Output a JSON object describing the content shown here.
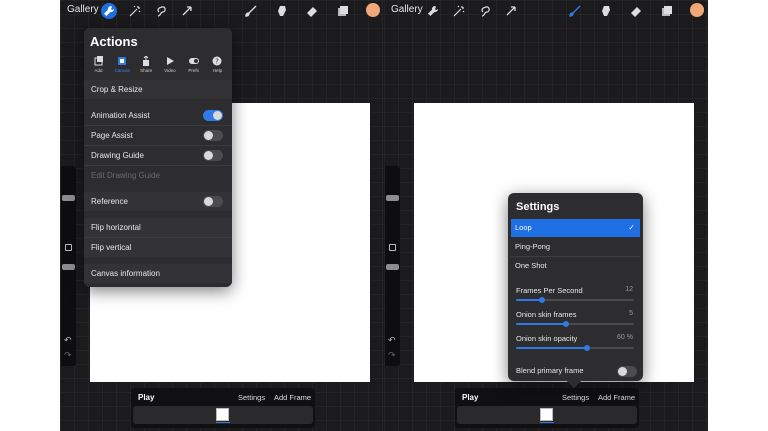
{
  "colors": {
    "accent": "#2f7ae5",
    "panel_bg": "#1b1b1d",
    "popover_bg": "#2d2d2f",
    "swatch": "#f0a878"
  },
  "left": {
    "topbar": {
      "gallery": "Gallery",
      "icons": [
        "wrench-icon",
        "magic-wand-icon",
        "selection-icon",
        "transform-icon",
        "brush-icon",
        "smudge-icon",
        "eraser-icon",
        "layers-icon",
        "color-swatch"
      ]
    },
    "anim_bar": {
      "play": "Play",
      "settings": "Settings",
      "add_frame": "Add Frame"
    },
    "actions": {
      "title": "Actions",
      "tabs": [
        {
          "label": "Add",
          "icon": "add-icon"
        },
        {
          "label": "Canvas",
          "icon": "canvas-icon",
          "active": true
        },
        {
          "label": "Share",
          "icon": "share-icon"
        },
        {
          "label": "Video",
          "icon": "video-icon"
        },
        {
          "label": "Prefs",
          "icon": "prefs-icon"
        },
        {
          "label": "Help",
          "icon": "help-icon"
        }
      ],
      "items": {
        "crop": "Crop & Resize",
        "animation_assist": {
          "label": "Animation Assist",
          "on": true
        },
        "page_assist": {
          "label": "Page Assist",
          "on": false
        },
        "drawing_guide": {
          "label": "Drawing Guide",
          "on": false
        },
        "edit_drawing_guide": "Edit Drawing Guide",
        "reference": {
          "label": "Reference",
          "on": false
        },
        "flip_h": "Flip horizontal",
        "flip_v": "Flip vertical",
        "canvas_info": "Canvas information"
      }
    }
  },
  "right": {
    "topbar": {
      "gallery": "Gallery"
    },
    "anim_bar": {
      "play": "Play",
      "settings": "Settings",
      "add_frame": "Add Frame"
    },
    "settings": {
      "title": "Settings",
      "options": {
        "loop": "Loop",
        "ping_pong": "Ping-Pong",
        "one_shot": "One Shot"
      },
      "selected": "Loop",
      "check": "✓",
      "fps": {
        "label": "Frames Per Second",
        "value": "12",
        "fraction": 0.22
      },
      "onion_frames": {
        "label": "Onion skin frames",
        "value": "5",
        "fraction": 0.42
      },
      "onion_opacity": {
        "label": "Onion skin opacity",
        "value": "60 %",
        "fraction": 0.6
      },
      "blend": {
        "label": "Blend primary frame",
        "on": false
      }
    }
  }
}
